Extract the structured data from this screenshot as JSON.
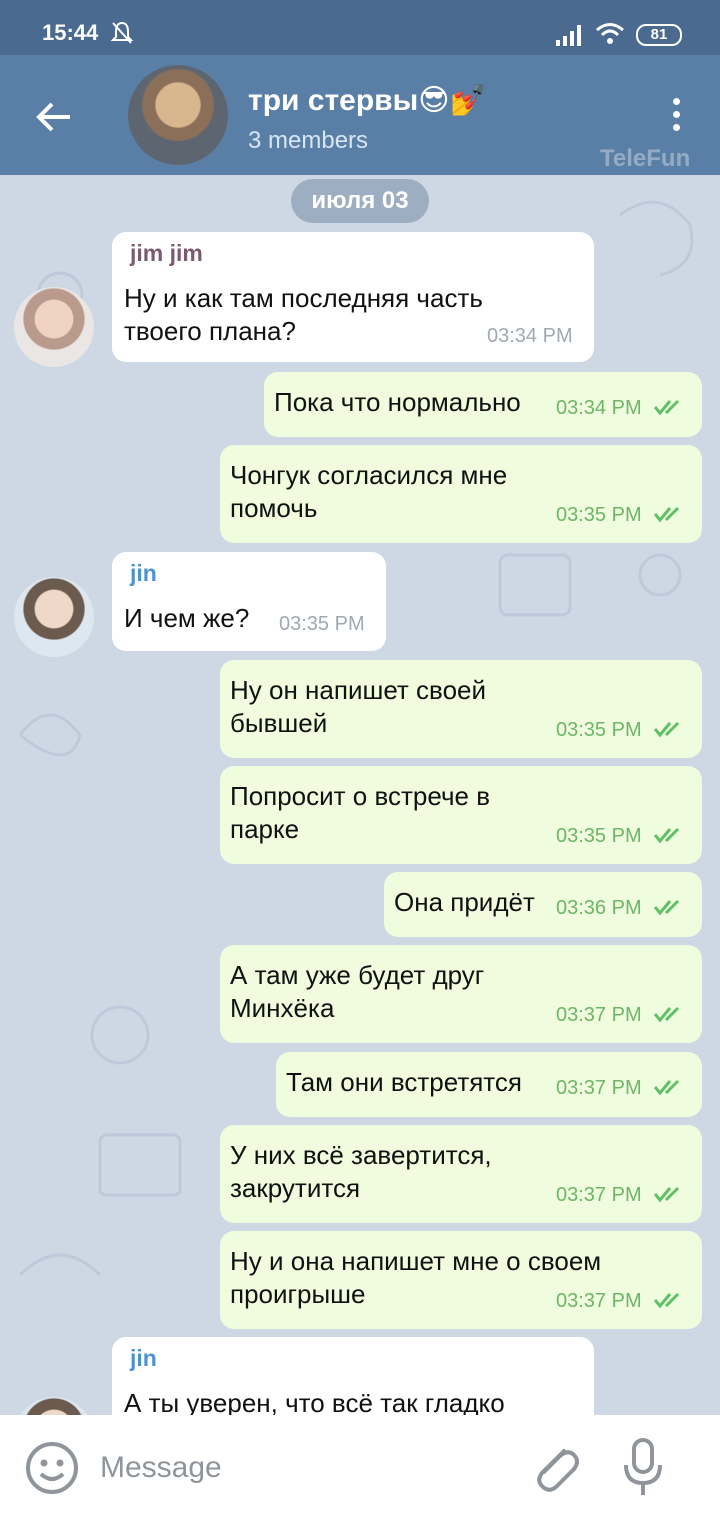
{
  "status_bar": {
    "time": "15:44",
    "battery": "81"
  },
  "header": {
    "title": "три стервы😎💅",
    "subtitle": "3 members",
    "watermark": "TeleFun",
    "back_icon": "arrow-left-icon",
    "menu_icon": "more-vert-icon"
  },
  "chat": {
    "date_pill": "июля 03",
    "messages": [
      {
        "side": "in",
        "sender": "jim jim",
        "text1": "Ну и как там последняя часть",
        "text2": "твоего плана?",
        "time": "03:34 PM"
      },
      {
        "side": "out",
        "text": "Пока что нормально",
        "time": "03:34 PM"
      },
      {
        "side": "out",
        "text1": "Чонгук согласился мне",
        "text2": "помочь",
        "time": "03:35 PM"
      },
      {
        "side": "in",
        "sender": "jin",
        "text": "И чем же?",
        "time": "03:35 PM"
      },
      {
        "side": "out",
        "text1": "Ну он напишет своей",
        "text2": "бывшей",
        "time": "03:35 PM"
      },
      {
        "side": "out",
        "text1": "Попросит о встрече в",
        "text2": "парке",
        "time": "03:35 PM"
      },
      {
        "side": "out",
        "text": "Она придёт",
        "time": "03:36 PM"
      },
      {
        "side": "out",
        "text1": "А там уже будет друг",
        "text2": "Минхёка",
        "time": "03:37 PM"
      },
      {
        "side": "out",
        "text": "Там они встретятся",
        "time": "03:37 PM"
      },
      {
        "side": "out",
        "text1": "У них всё завертится,",
        "text2": "закрутится",
        "time": "03:37 PM"
      },
      {
        "side": "out",
        "text1": "Ну и она напишет мне о своем",
        "text2": "проигрыше",
        "time": "03:37 PM"
      },
      {
        "side": "in",
        "sender": "jin",
        "text": "А ты уверен, что всё так гладко"
      }
    ]
  },
  "colors": {
    "header": "#5a7fa6",
    "status_bar": "#4a6a8f",
    "jim_name": "#7a5a6e",
    "jin_name": "#4f92d1",
    "outgoing_bubble": "#effdde",
    "check": "#5fc067"
  },
  "input_bar": {
    "placeholder": "Message",
    "emoji_icon": "emoji-smile-icon",
    "attach_icon": "paperclip-icon",
    "mic_icon": "microphone-icon"
  }
}
